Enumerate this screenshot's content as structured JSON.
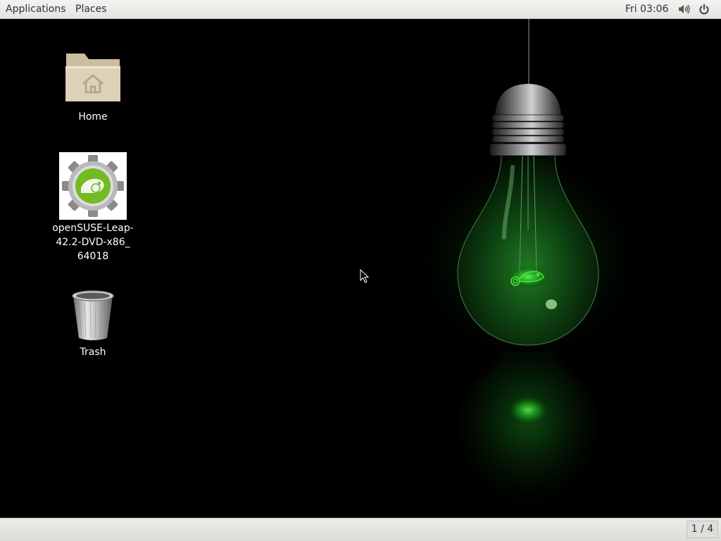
{
  "top_bar": {
    "applications_label": "Applications",
    "places_label": "Places",
    "clock": "Fri 03:06",
    "icons": {
      "volume": "speaker-volume-icon",
      "power": "power-icon"
    }
  },
  "desktop": {
    "wallpaper": "opensuse-green-lightbulb-wallpaper",
    "icons": [
      {
        "label": "Home",
        "icon": "home-folder-icon"
      },
      {
        "label": "openSUSE-Leap-\n42.2-DVD-x86_\n64018",
        "icon": "opensuse-installer-icon"
      },
      {
        "label": "Trash",
        "icon": "trash-icon"
      }
    ]
  },
  "bottom_bar": {
    "workspace_indicator": "1 / 4"
  },
  "colors": {
    "panel_bg": "#e8e8e5",
    "panel_text": "#2e3436",
    "desktop_bg": "#000000",
    "bulb_glow": "#39ff4a"
  }
}
